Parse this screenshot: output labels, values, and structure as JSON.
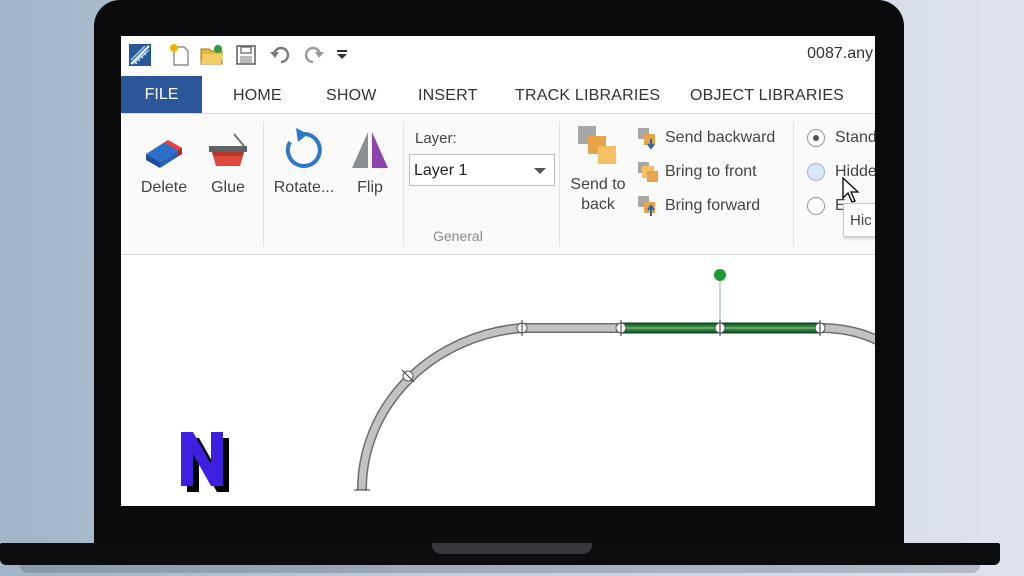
{
  "window": {
    "doc_title": "0087.any"
  },
  "quick_access": {
    "icons": [
      "app-logo-icon",
      "new-file-icon",
      "open-folder-icon",
      "save-icon",
      "undo-icon",
      "redo-icon",
      "customize-dropdown-icon"
    ]
  },
  "tabs": {
    "file": "FILE",
    "items": [
      "HOME",
      "SHOW",
      "INSERT",
      "TRACK LIBRARIES",
      "OBJECT LIBRARIES"
    ]
  },
  "ribbon": {
    "delete_label": "Delete",
    "glue_label": "Glue",
    "rotate_label": "Rotate...",
    "flip_label": "Flip",
    "layer_label": "Layer:",
    "layer_value": "Layer 1",
    "send_to_back_line1": "Send to",
    "send_to_back_line2": "back",
    "send_backward": "Send backward",
    "bring_to_front": "Bring to front",
    "bring_forward": "Bring forward",
    "group_label": "General",
    "radio_options": [
      "Stand",
      "Hidde",
      "E"
    ],
    "radio_selected_index": 0,
    "tooltip_text": "Hic"
  },
  "colors": {
    "file_tab": "#2b579a",
    "track": "#b9b9b9",
    "selected_track": "#1e6b2e",
    "handle": "#1e9b2e",
    "logo_fill": "#3d1fe0"
  },
  "canvas": {
    "logo_letter": "N"
  }
}
